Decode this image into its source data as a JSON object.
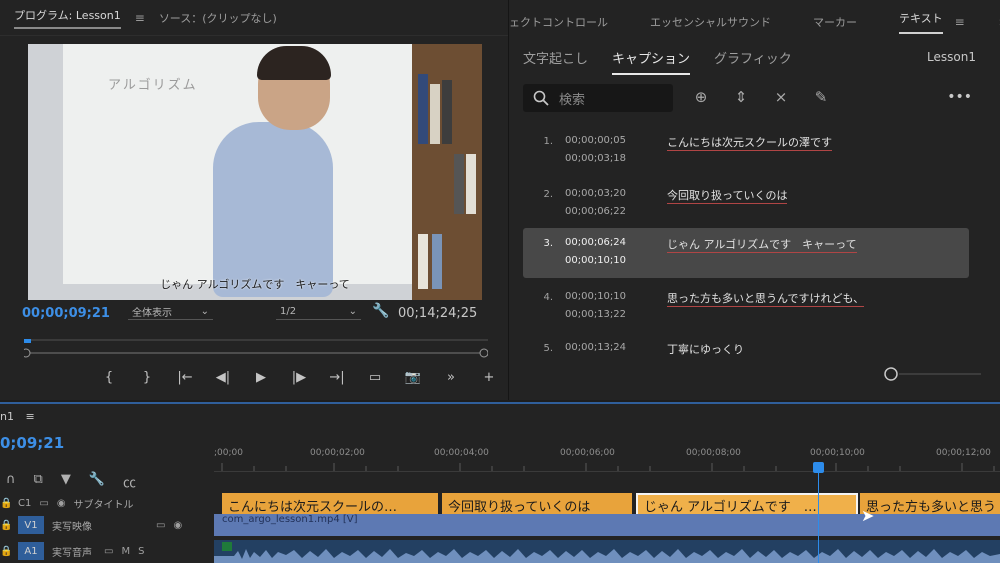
{
  "program": {
    "tab_label": "プログラム: Lesson1",
    "tab_menu": "≡",
    "source_tab": "ソース：(クリップなし)",
    "whiteboard_text": "アルゴリズム",
    "caption_overlay": "じゃん アルゴリズムです　キャーって",
    "timecode": "00;00;09;21",
    "fit_label": "全体表示",
    "resolution_label": "1/2",
    "duration": "00;14;24;25",
    "controls": [
      "{",
      "}",
      "|←",
      "◀|",
      "▶",
      "|▶",
      "→|",
      "▭",
      "📷",
      "»",
      "+"
    ]
  },
  "text_panel": {
    "tabs": [
      {
        "label": "ェクトコントロール"
      },
      {
        "label": "エッセンシャルサウンド"
      },
      {
        "label": "マーカー"
      },
      {
        "label": "テキスト"
      }
    ],
    "tab_menu": "≡",
    "overflow": "»",
    "sub_tabs": [
      {
        "label": "文字起こし"
      },
      {
        "label": "キャプション"
      },
      {
        "label": "グラフィック"
      }
    ],
    "sequence_name": "Lesson1",
    "search_placeholder": "検索",
    "more": "•••",
    "captions": [
      {
        "index": "1.",
        "in": "00;00;00;05",
        "out": "00;00;03;18",
        "text": "こんにちは次元スクールの澤です"
      },
      {
        "index": "2.",
        "in": "00;00;03;20",
        "out": "00;00;06;22",
        "text": "今回取り扱っていくのは"
      },
      {
        "index": "3.",
        "in": "00;00;06;24",
        "out": "00;00;10;10",
        "text": "じゃん アルゴリズムです　キャーって"
      },
      {
        "index": "4.",
        "in": "00;00;10;10",
        "out": "00;00;13;22",
        "text": "思った方も多いと思うんですけれども、"
      },
      {
        "index": "5.",
        "in": "00;00;13;24",
        "out": "",
        "text": "丁寧にゆっくり"
      }
    ]
  },
  "timeline": {
    "name": "n1",
    "menu": "≡",
    "timecode": "0;09;21",
    "ruler": [
      ";00;00",
      "00;00;02;00",
      "00;00;04;00",
      "00;00;06;00",
      "00;00;08;00",
      "00;00;10;00",
      "00;00;12;00"
    ],
    "tracks": [
      {
        "id": "C1",
        "name": "サブタイトル"
      },
      {
        "id": "V1",
        "name": "実写映像"
      },
      {
        "id": "A1",
        "name": "実写音声"
      }
    ],
    "clips": [
      {
        "text": "こんにちは次元スクールの…"
      },
      {
        "text": "今回取り扱っていくのは"
      },
      {
        "text": "じゃん アルゴリズムです　…"
      },
      {
        "text": "思った方も多いと思う"
      }
    ],
    "video_clip": "com_argo_lesson1.mp4 [V]",
    "audio_track_labels": [
      "M",
      "S"
    ]
  }
}
